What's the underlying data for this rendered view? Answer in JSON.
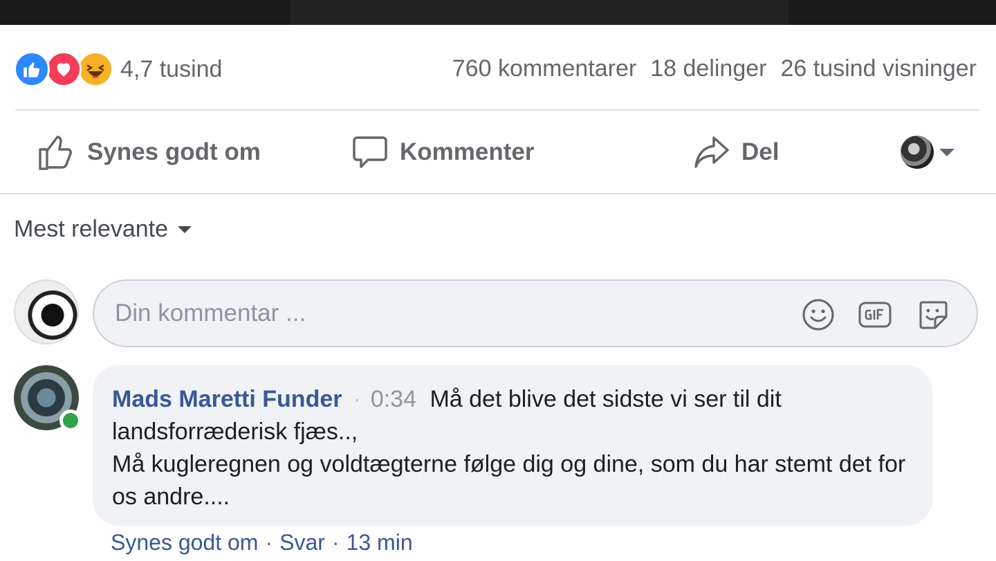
{
  "reactions": {
    "icons": [
      "like-icon",
      "love-icon",
      "haha-icon"
    ],
    "count": "4,7 tusind"
  },
  "stats": {
    "comments": "760 kommentarer",
    "shares": "18 delinger",
    "views": "26 tusind visninger"
  },
  "actions": {
    "like": "Synes godt om",
    "comment": "Kommenter",
    "share": "Del"
  },
  "sort": {
    "label": "Mest relevante"
  },
  "composer": {
    "placeholder": "Din kommentar ..."
  },
  "comment": {
    "author": "Mads Maretti Funder",
    "separator": "·",
    "timestamp": "0:34",
    "text_line1": "Må det blive det sidste vi ser til dit landsforræderisk fjæs..,",
    "text_line2": "Må kugleregnen og voldtægterne følge dig og dine, som du har stemt det for os andre....",
    "like_link": "Synes godt om",
    "dot": "·",
    "reply_link": "Svar",
    "age": "13 min"
  },
  "colors": {
    "like_blue": "#2d88ff",
    "love_red": "#f33e58",
    "haha_yellow": "#f7b125",
    "author_link": "#385898",
    "online_green": "#31a24c"
  }
}
